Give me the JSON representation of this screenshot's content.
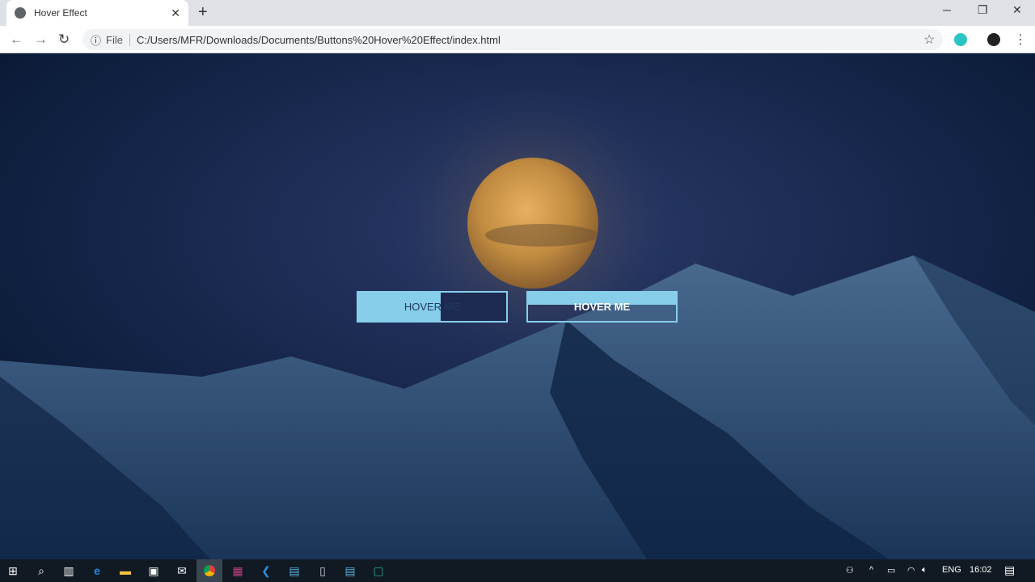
{
  "browser": {
    "tab_title": "Hover Effect",
    "new_tab": "+",
    "close_tab": "✕",
    "minimize": "─",
    "maximize": "❐",
    "close": "✕",
    "back": "←",
    "forward": "→",
    "reload": "↻",
    "info": "ⓘ",
    "scheme_label": "File",
    "url": "C:/Users/MFR/Downloads/Documents/Buttons%20Hover%20Effect/index.html",
    "bookmark": "☆",
    "menu": "⋮"
  },
  "page": {
    "button1_label": "HOVER ME",
    "button2_label": "HOVER ME",
    "button1_fill_percent": 56,
    "accent": "#87ceeb"
  },
  "taskbar": {
    "icons": [
      "windows-start",
      "search",
      "task-view",
      "edge",
      "file-explorer",
      "store",
      "mail",
      "chrome",
      "winrar",
      "vscode",
      "app-1",
      "notepad",
      "app-2",
      "app-3"
    ],
    "lang": "ENG",
    "time": "16:02"
  }
}
